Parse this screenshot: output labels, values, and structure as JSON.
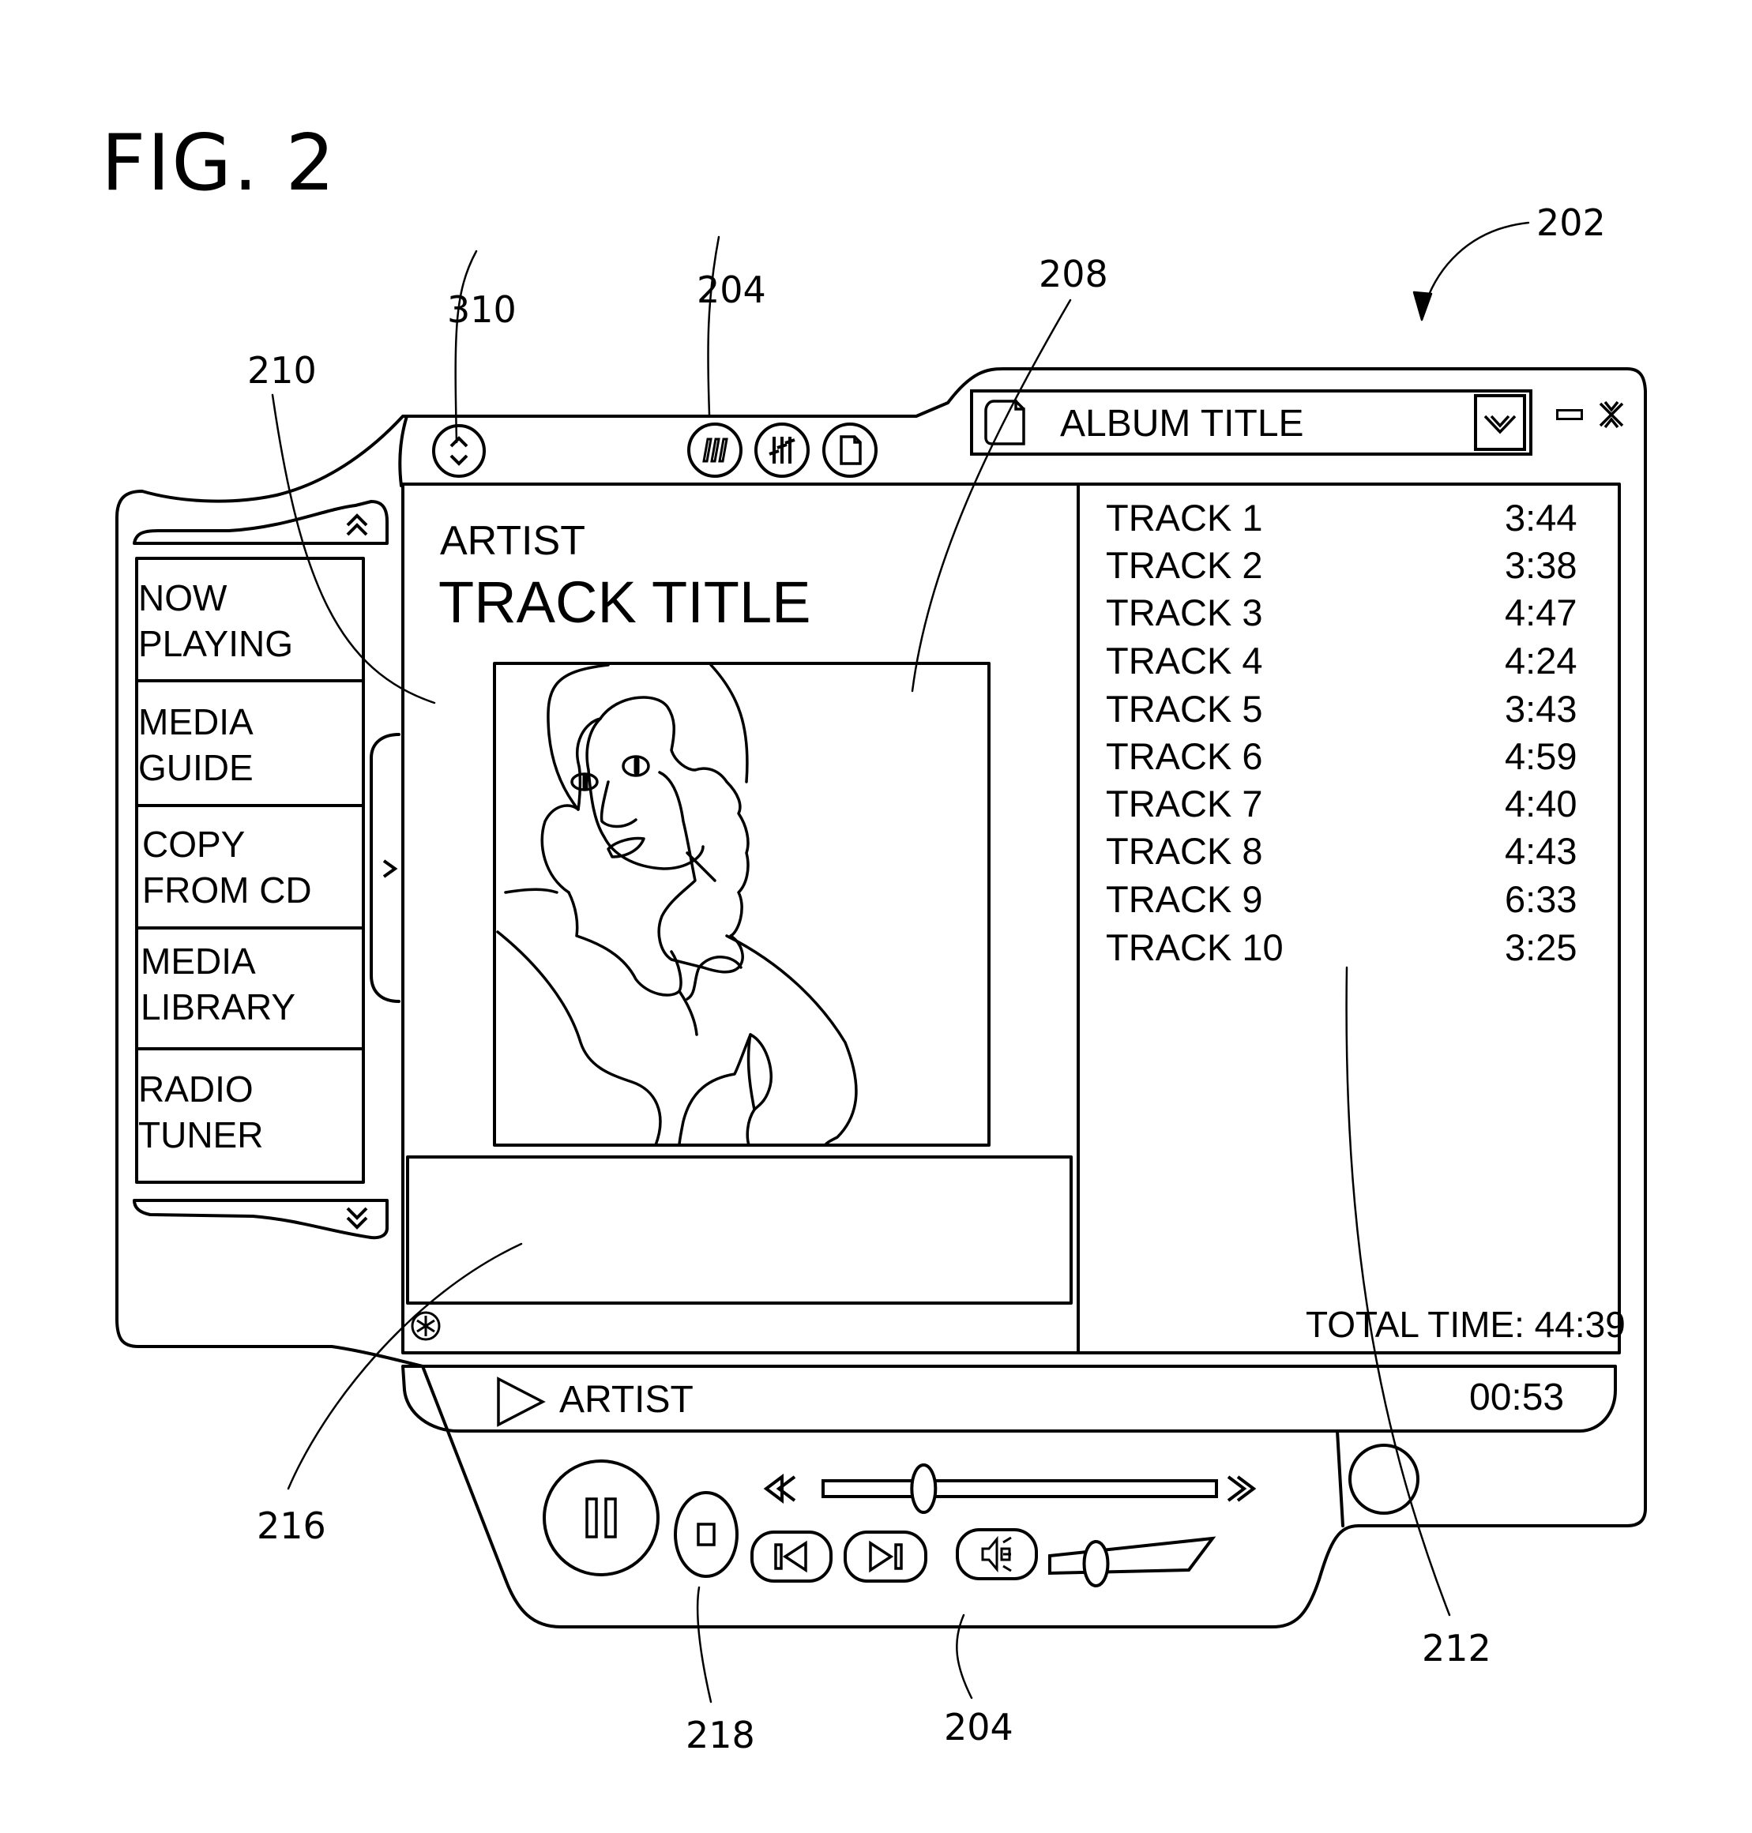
{
  "figure": {
    "title": "FIG. 2",
    "reference_numerals": {
      "window": "202",
      "toolbar_top": "204",
      "toolbar_bottom": "204",
      "album_art": "208",
      "nav_pane": "210",
      "playlist": "212",
      "info_pane": "216",
      "transport_controls": "218",
      "view_toggle": "310"
    }
  },
  "header": {
    "album_selector": {
      "icon": "document-icon",
      "value": "ALBUM TITLE",
      "dropdown_icon": "chevron-down-icon"
    },
    "window_controls": {
      "minimize_icon": "minimize-icon",
      "close_icon": "close-icon"
    },
    "toolbar_icons": [
      "visualization-icon",
      "equalizer-icon",
      "document-icon"
    ],
    "view_toggle_icon": "up-down-arrows-icon"
  },
  "sidebar": {
    "scroll_up_icon": "double-chevron-up-icon",
    "scroll_down_icon": "double-chevron-down-icon",
    "expand_icon": "chevron-right-icon",
    "items": [
      {
        "line1": "NOW",
        "line2": "PLAYING"
      },
      {
        "line1": "MEDIA",
        "line2": "GUIDE"
      },
      {
        "line1": "COPY",
        "line2": "FROM CD"
      },
      {
        "line1": "MEDIA",
        "line2": "LIBRARY"
      },
      {
        "line1": "RADIO",
        "line2": "TUNER"
      }
    ]
  },
  "now_playing": {
    "artist": "ARTIST",
    "track_title": "TRACK TITLE",
    "info_icon": "asterisk-circle-icon"
  },
  "playlist": {
    "tracks": [
      {
        "name": "TRACK 1",
        "duration": "3:44"
      },
      {
        "name": "TRACK 2",
        "duration": "3:38"
      },
      {
        "name": "TRACK 3",
        "duration": "4:47"
      },
      {
        "name": "TRACK 4",
        "duration": "4:24"
      },
      {
        "name": "TRACK 5",
        "duration": "3:43"
      },
      {
        "name": "TRACK 6",
        "duration": "4:59"
      },
      {
        "name": "TRACK 7",
        "duration": "4:40"
      },
      {
        "name": "TRACK 8",
        "duration": "4:43"
      },
      {
        "name": "TRACK 9",
        "duration": "6:33"
      },
      {
        "name": "TRACK 10",
        "duration": "3:25"
      }
    ],
    "total_time": "TOTAL TIME: 44:39"
  },
  "status_bar": {
    "play_icon": "play-icon",
    "artist": "ARTIST",
    "elapsed": "00:53"
  },
  "transport": {
    "pause_icon": "pause-icon",
    "stop_icon": "stop-icon",
    "previous_icon": "previous-track-icon",
    "next_icon": "next-track-icon",
    "rewind_icon": "rewind-icon",
    "fast_forward_icon": "fast-forward-icon",
    "mute_icon": "speaker-icon",
    "seek_position_fraction": 0.24,
    "volume_fraction": 0.25
  }
}
